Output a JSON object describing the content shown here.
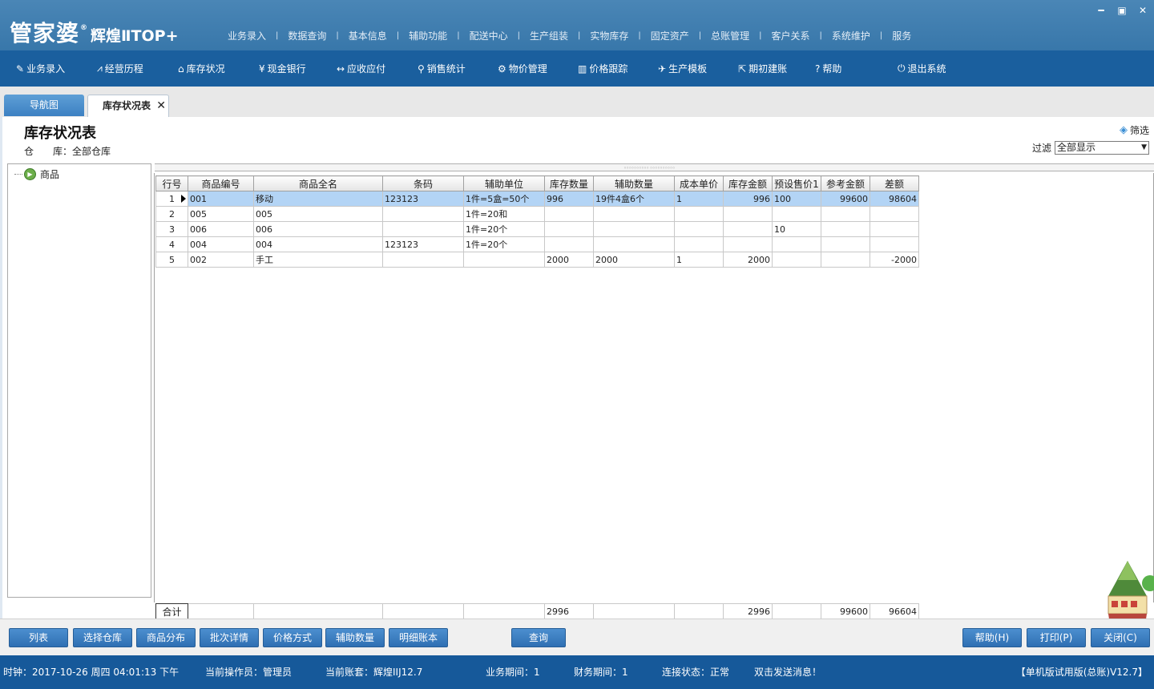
{
  "app": {
    "logo_main": "管家婆",
    "logo_reg": "®",
    "logo_sub": "辉煌ⅡTOP+",
    "window_controls": [
      "minimize-icon",
      "maximize-icon",
      "close-icon"
    ]
  },
  "top_menu": [
    "业务录入",
    "数据查询",
    "基本信息",
    "辅助功能",
    "配送中心",
    "生产组装",
    "实物库存",
    "固定资产",
    "总账管理",
    "客户关系",
    "系统维护",
    "服务"
  ],
  "toolbar": [
    {
      "label": "业务录入",
      "icon": "edit-icon",
      "glyph": "✎"
    },
    {
      "label": "经营历程",
      "icon": "line-chart-icon",
      "glyph": "⩘"
    },
    {
      "label": "库存状况",
      "icon": "home-icon",
      "glyph": "⌂"
    },
    {
      "label": "现金银行",
      "icon": "yen-icon",
      "glyph": "¥"
    },
    {
      "label": "应收应付",
      "icon": "exchange-icon",
      "glyph": "↔"
    },
    {
      "label": "销售统计",
      "icon": "search-icon",
      "glyph": "⚲"
    },
    {
      "label": "物价管理",
      "icon": "gear-icon",
      "glyph": "⚙"
    },
    {
      "label": "价格跟踪",
      "icon": "bar-chart-icon",
      "glyph": "▥"
    },
    {
      "label": "生产模板",
      "icon": "wrench-icon",
      "glyph": "✈"
    },
    {
      "label": "期初建账",
      "icon": "external-icon",
      "glyph": "⇱"
    },
    {
      "label": "帮助",
      "icon": "help-icon",
      "glyph": "?"
    },
    {
      "label": "退出系统",
      "icon": "power-icon",
      "glyph": "⏻"
    }
  ],
  "tabs": {
    "nav_label": "导航图",
    "active_label": "库存状况表",
    "close_glyph": "✕"
  },
  "page": {
    "title": "库存状况表",
    "warehouse_line": "仓　　库：全部仓库",
    "filter_link": "筛选",
    "filter_label": "过滤",
    "filter_value": "全部显示"
  },
  "tree": {
    "root_label": "商品"
  },
  "table": {
    "columns": [
      "行号",
      "商品编号",
      "商品全名",
      "条码",
      "辅助单位",
      "库存数量",
      "辅助数量",
      "成本单价",
      "库存金额",
      "预设售价1",
      "参考金额",
      "差额"
    ],
    "rows": [
      [
        "1",
        "001",
        "移动",
        "123123",
        "1件=5盒=50个",
        "996",
        "19件4盒6个",
        "1",
        "996",
        "100",
        "99600",
        "98604"
      ],
      [
        "2",
        "005",
        "005",
        "",
        "1件=20和",
        "",
        "",
        "",
        "",
        "",
        "",
        ""
      ],
      [
        "3",
        "006",
        "006",
        "",
        "1件=20个",
        "",
        "",
        "",
        "",
        "10",
        "",
        ""
      ],
      [
        "4",
        "004",
        "004",
        "123123",
        "1件=20个",
        "",
        "",
        "",
        "",
        "",
        "",
        ""
      ],
      [
        "5",
        "002",
        "手工",
        "",
        "",
        "2000",
        "2000",
        "1",
        "2000",
        "",
        "",
        "-2000"
      ]
    ],
    "selected_row": 0,
    "totals_label": "合计",
    "totals": [
      "",
      "",
      "",
      "",
      "2996",
      "",
      "",
      "2996",
      "",
      "99600",
      "96604"
    ]
  },
  "buttons_left": [
    "列表",
    "选择仓库",
    "商品分布",
    "批次详情",
    "价格方式",
    "辅助数量",
    "明细账本"
  ],
  "button_query": "查询",
  "buttons_right": [
    "帮助(H)",
    "打印(P)",
    "关闭(C)"
  ],
  "status": {
    "clock": "时钟：2017-10-26 周四 04:01:13 下午",
    "operator": "当前操作员：管理员",
    "account": "当前账套：辉煌IIJ12.7",
    "biz_period": "业务期间：1",
    "fin_period": "财务期间：1",
    "connection": "连接状态：正常",
    "message": "双击发送消息！",
    "version": "【单机版试用版(总账)V12.7】"
  }
}
